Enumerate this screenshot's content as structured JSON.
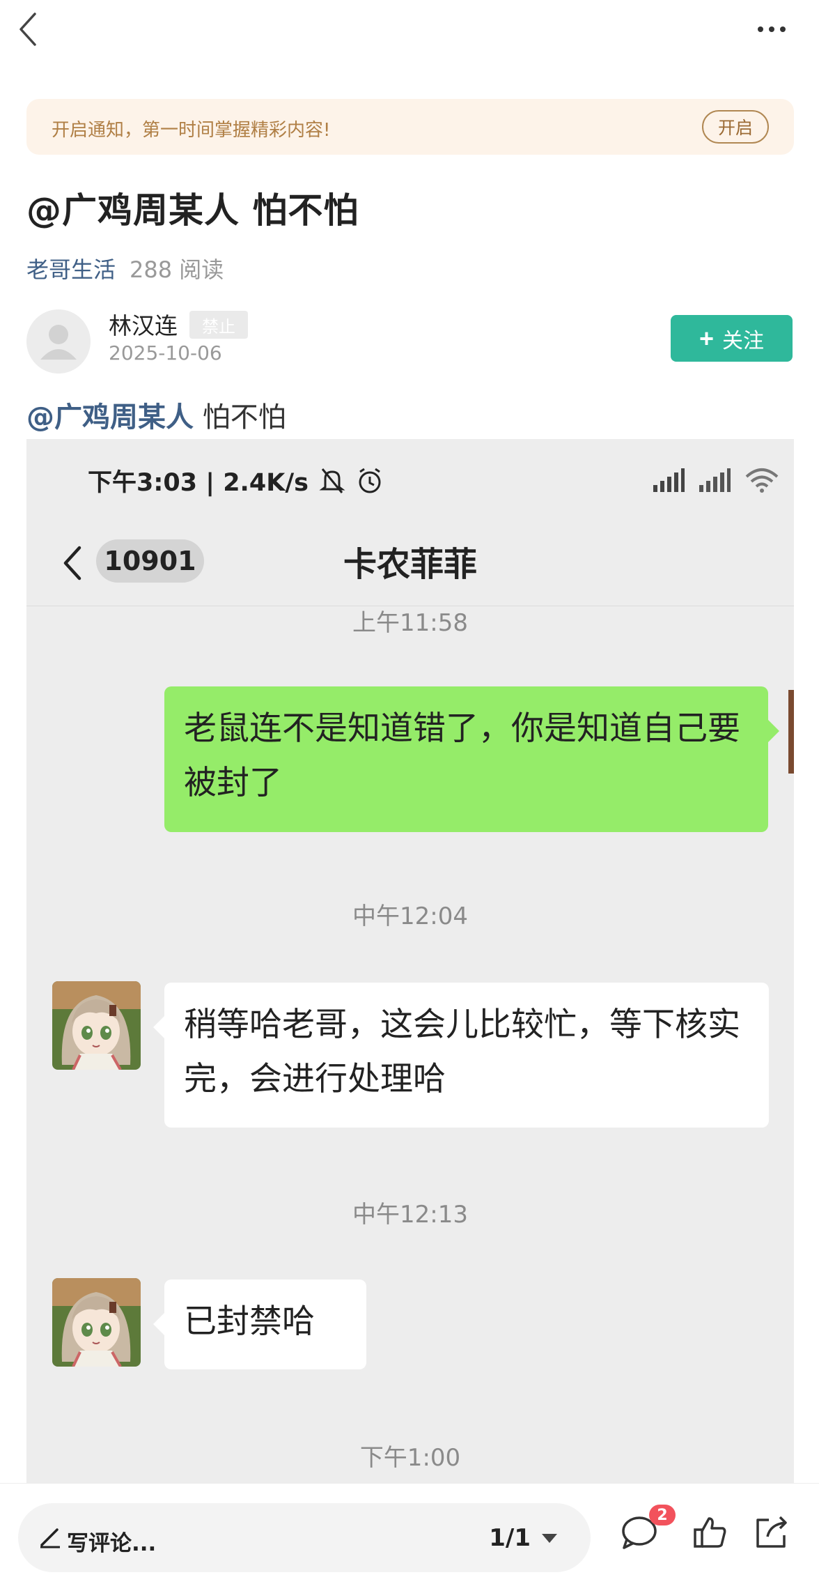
{
  "notice": {
    "text": "开启通知，第一时间掌握精彩内容!",
    "button": "开启"
  },
  "article": {
    "title": "@广鸡周某人 怕不怕",
    "channel": "老哥生活",
    "reads": "288 阅读",
    "author": {
      "name": "林汉连",
      "badge": "禁止",
      "date": "2025-10-06"
    },
    "follow_label": "关注",
    "body_mention": "@广鸡周某人",
    "body_rest": " 怕不怕"
  },
  "screenshot": {
    "status_text": "下午3:03 | 2.4K/s",
    "unread_count": "10901",
    "chat_title": "卡农菲菲",
    "messages": [
      {
        "time": "上午11:58"
      },
      {
        "from": "me",
        "text": "老鼠连不是知道错了，你是知道自己要被封了"
      },
      {
        "time": "中午12:04"
      },
      {
        "from": "other",
        "text": "稍等哈老哥，这会儿比较忙，等下核实完，会进行处理哈"
      },
      {
        "time": "中午12:13"
      },
      {
        "from": "other",
        "text": "已封禁哈"
      },
      {
        "time": "下午1:00"
      }
    ]
  },
  "bottombar": {
    "comment_placeholder": "写评论...",
    "pager": "1/1",
    "comment_badge": "2"
  },
  "colors": {
    "follow": "#2fb89b",
    "mention": "#3f5f86",
    "green_bubble": "#95ec69",
    "badge": "#f2525c"
  }
}
